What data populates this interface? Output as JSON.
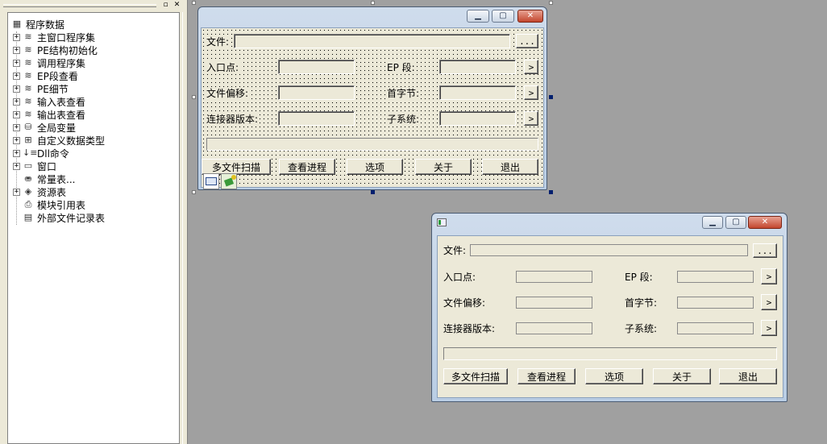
{
  "tree": {
    "root_label": "程序数据",
    "items": [
      {
        "label": "主窗口程序集",
        "icon": "program-set-icon",
        "glyph": "≋",
        "expand": "+"
      },
      {
        "label": "PE结构初始化",
        "icon": "program-set-icon",
        "glyph": "≋",
        "expand": "+"
      },
      {
        "label": "调用程序集",
        "icon": "program-set-icon",
        "glyph": "≋",
        "expand": "+"
      },
      {
        "label": "EP段查看",
        "icon": "program-set-icon",
        "glyph": "≋",
        "expand": "+"
      },
      {
        "label": "PE细节",
        "icon": "program-set-icon",
        "glyph": "≋",
        "expand": "+"
      },
      {
        "label": "输入表查看",
        "icon": "program-set-icon",
        "glyph": "≋",
        "expand": "+"
      },
      {
        "label": "输出表查看",
        "icon": "program-set-icon",
        "glyph": "≋",
        "expand": "+"
      },
      {
        "label": "全局变量",
        "icon": "database-icon",
        "glyph": "⛁",
        "expand": "+"
      },
      {
        "label": "自定义数据类型",
        "icon": "data-type-icon",
        "glyph": "⊞",
        "expand": "+"
      },
      {
        "label": "Dll命令",
        "icon": "dll-command-icon",
        "glyph": "↓≡",
        "expand": "+"
      },
      {
        "label": "窗口",
        "icon": "window-icon",
        "glyph": "▭",
        "expand": "+"
      },
      {
        "label": "常量表...",
        "icon": "constant-table-icon",
        "glyph": "⛂",
        "expand": ""
      },
      {
        "label": "资源表",
        "icon": "resource-table-icon",
        "glyph": "◈",
        "expand": "+"
      },
      {
        "label": "模块引用表",
        "icon": "module-reference-icon",
        "glyph": "⎙",
        "expand": ""
      },
      {
        "label": "外部文件记录表",
        "icon": "external-file-icon",
        "glyph": "▤",
        "expand": ""
      }
    ]
  },
  "panel_buttons": {
    "restore": "▫",
    "close": "✕"
  },
  "form": {
    "file_label": "文件:",
    "browse_label": "...",
    "entry_label": "入口点:",
    "ep_section_label": "EP 段:",
    "file_offset_label": "文件偏移:",
    "first_byte_label": "首字节:",
    "linker_version_label": "连接器版本:",
    "subsystem_label": "子系统:",
    "arrow_label": ">",
    "multi_scan_label": "多文件扫描",
    "view_process_label": "查看进程",
    "options_label": "选项",
    "about_label": "关于",
    "exit_label": "退出"
  },
  "caption_buttons": {
    "minimize": "▁",
    "maximize": "▢",
    "close": "✕"
  },
  "colors": {
    "canvas": "#a0a0a0",
    "dialog_face": "#ece9d8",
    "close_red": "#c3462e",
    "selection_handle": "#001f6e"
  }
}
